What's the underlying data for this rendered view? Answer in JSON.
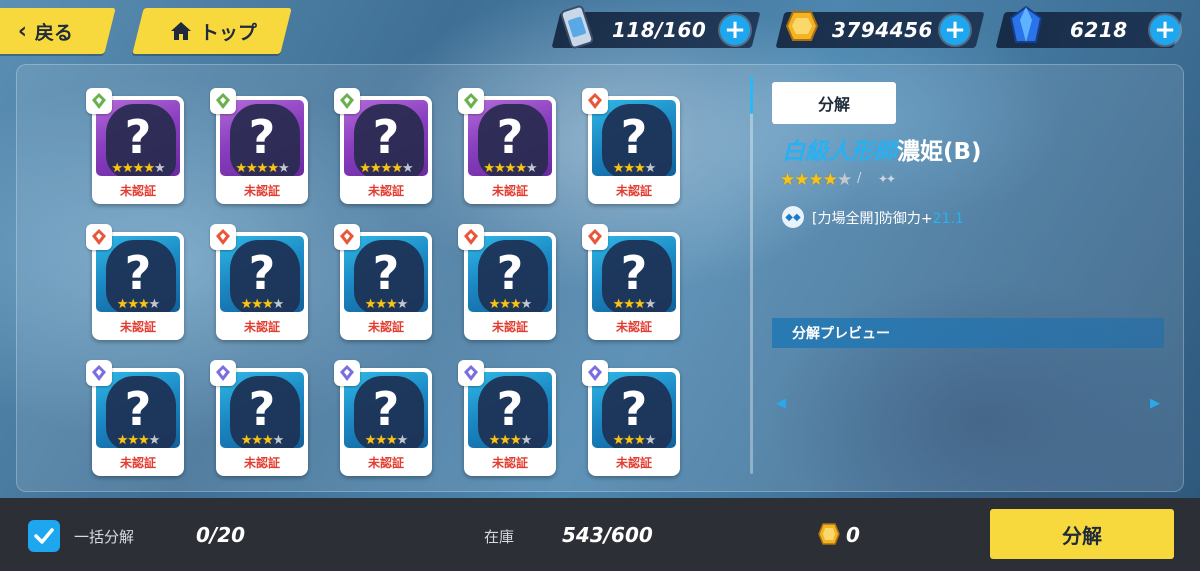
{
  "header": {
    "back_label": "戻る",
    "top_label": "トップ",
    "stamina": "118/160",
    "coins": "3794456",
    "crystals": "6218"
  },
  "cards": [
    {
      "rarity": "purple",
      "badge": "green",
      "stars": 4,
      "label": "未認証"
    },
    {
      "rarity": "purple",
      "badge": "green",
      "stars": 4,
      "label": "未認証"
    },
    {
      "rarity": "purple",
      "badge": "green",
      "stars": 4,
      "label": "未認証"
    },
    {
      "rarity": "purple",
      "badge": "green",
      "stars": 4,
      "label": "未認証"
    },
    {
      "rarity": "blue",
      "badge": "red",
      "stars": 3,
      "label": "未認証"
    },
    {
      "rarity": "blue",
      "badge": "red",
      "stars": 3,
      "label": "未認証"
    },
    {
      "rarity": "blue",
      "badge": "red",
      "stars": 3,
      "label": "未認証"
    },
    {
      "rarity": "blue",
      "badge": "red",
      "stars": 3,
      "label": "未認証"
    },
    {
      "rarity": "blue",
      "badge": "red",
      "stars": 3,
      "label": "未認証"
    },
    {
      "rarity": "blue",
      "badge": "red",
      "stars": 3,
      "label": "未認証"
    },
    {
      "rarity": "blue",
      "badge": "violet",
      "stars": 3,
      "label": "未認証"
    },
    {
      "rarity": "blue",
      "badge": "violet",
      "stars": 3,
      "label": "未認証"
    },
    {
      "rarity": "blue",
      "badge": "violet",
      "stars": 3,
      "label": "未認証"
    },
    {
      "rarity": "blue",
      "badge": "violet",
      "stars": 3,
      "label": "未認証"
    },
    {
      "rarity": "blue",
      "badge": "violet",
      "stars": 3,
      "label": "未認証"
    }
  ],
  "detail": {
    "tab_label": "分解",
    "name_accent": "白級人形師",
    "name_rest": "濃姫(B)",
    "stars": 4,
    "skill_text": "[力場全開]防御力+",
    "skill_value": "21.1",
    "preview_label": "分解プレビュー"
  },
  "footer": {
    "bulk_label": "一括分解",
    "bulk_count": "0/20",
    "stock_label": "在庫",
    "stock_value": "543/600",
    "coin_value": "0",
    "confirm_label": "分解"
  },
  "colors": {
    "accent": "#27b0f2",
    "button": "#f7d93d",
    "card_label": "#e23c2f"
  }
}
